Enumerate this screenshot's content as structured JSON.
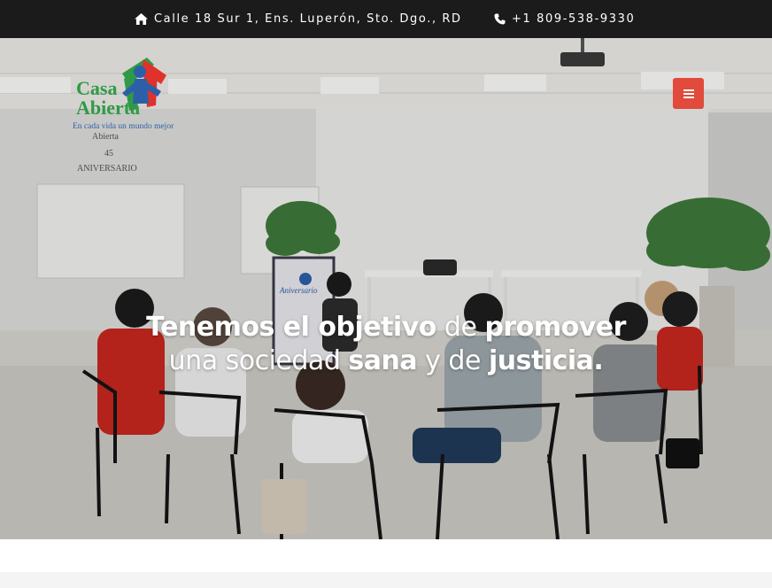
{
  "topbar": {
    "address_icon": "home-icon",
    "address": "Calle 18 Sur 1, Ens. Luperón, Sto. Dgo., RD",
    "phone_icon": "phone-icon",
    "phone": "+1 809-538-9330"
  },
  "brand": {
    "logo_line1": "Casa",
    "logo_line2": "Abierta",
    "tagline": "En cada vida un mundo mejor",
    "colors": {
      "green": "#2f9a45",
      "red": "#e0322b",
      "blue": "#2d5fa8"
    }
  },
  "nav": {
    "menu_icon": "hamburger-menu-icon",
    "menu_color": "#e14b3b"
  },
  "hero": {
    "line1": [
      {
        "text": "Tenemos el objetivo",
        "bold": true
      },
      {
        "text": " de ",
        "bold": false
      },
      {
        "text": "promover",
        "bold": true
      }
    ],
    "line2": [
      {
        "text": "una sociedad ",
        "bold": false
      },
      {
        "text": "sana",
        "bold": true
      },
      {
        "text": " y de ",
        "bold": false
      },
      {
        "text": "justicia.",
        "bold": true
      }
    ],
    "scene_texts": {
      "wall_line1": "Abierta",
      "wall_line2": "45",
      "wall_line3": "ANIVERSARIO",
      "banner": "Aniversario"
    }
  }
}
